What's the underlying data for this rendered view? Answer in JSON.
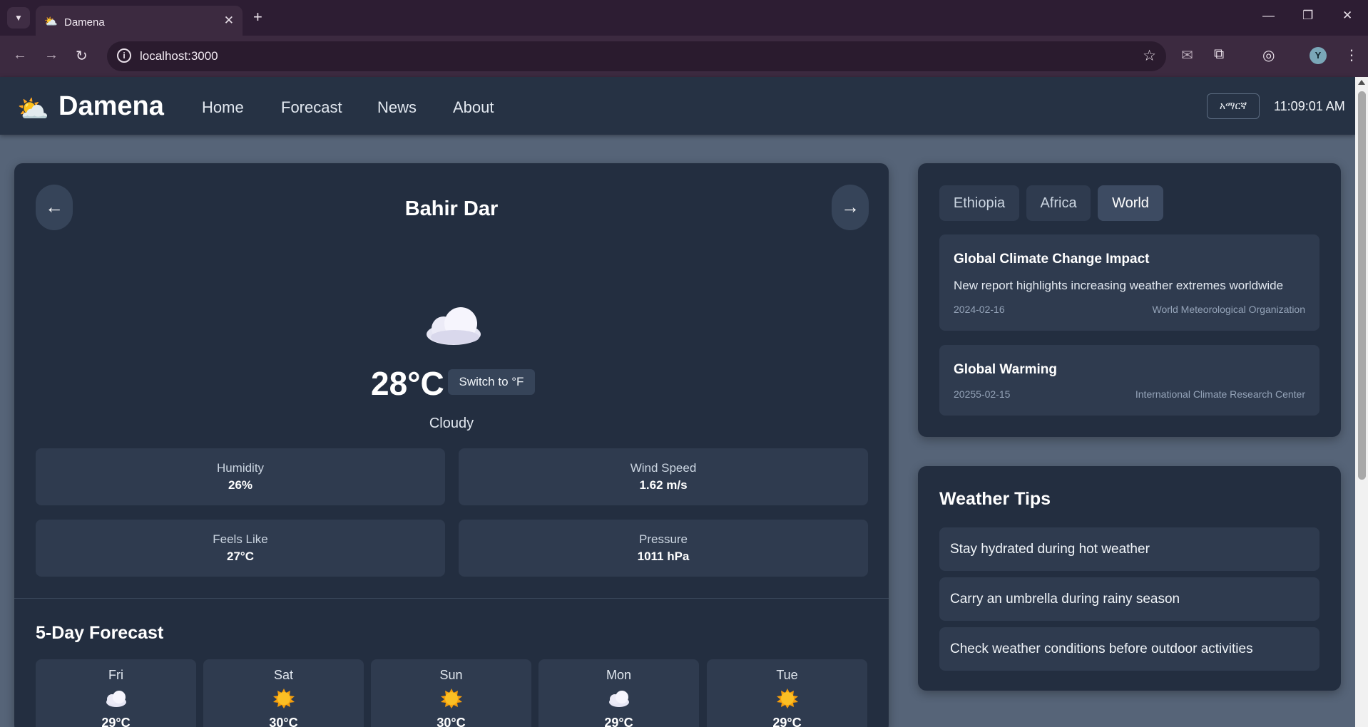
{
  "browser": {
    "tab_title": "Damena",
    "url": "localhost:3000",
    "profile_initial": "Y"
  },
  "app": {
    "name": "Damena",
    "nav": [
      "Home",
      "Forecast",
      "News",
      "About"
    ],
    "lang_button": "አማርኛ",
    "time": "11:09:01 AM"
  },
  "weather": {
    "city": "Bahir Dar",
    "prev_label": "←",
    "next_label": "→",
    "temperature": "28°C",
    "unit_toggle": "Switch to °F",
    "condition": "Cloudy",
    "stats": [
      {
        "label": "Humidity",
        "value": "26%"
      },
      {
        "label": "Wind Speed",
        "value": "1.62 m/s"
      },
      {
        "label": "Feels Like",
        "value": "27°C"
      },
      {
        "label": "Pressure",
        "value": "1011 hPa"
      }
    ]
  },
  "forecast": {
    "title": "5-Day Forecast",
    "days": [
      {
        "day": "Fri",
        "icon": "cloud-icon",
        "temp": "29°C"
      },
      {
        "day": "Sat",
        "icon": "sun-icon",
        "temp": "30°C"
      },
      {
        "day": "Sun",
        "icon": "sun-icon",
        "temp": "30°C"
      },
      {
        "day": "Mon",
        "icon": "cloud-icon",
        "temp": "29°C"
      },
      {
        "day": "Tue",
        "icon": "sun-icon",
        "temp": "29°C"
      }
    ]
  },
  "news": {
    "tabs": [
      "Ethiopia",
      "Africa",
      "World"
    ],
    "active_tab": "World",
    "items": [
      {
        "title": "Global Climate Change Impact",
        "description": "New report highlights increasing weather extremes worldwide",
        "date": "2024-02-16",
        "source": "World Meteorological Organization"
      },
      {
        "title": "Global Warming",
        "date": "20255-02-15",
        "source": "International Climate Research Center"
      }
    ]
  },
  "tips": {
    "title": "Weather Tips",
    "items": [
      "Stay hydrated during hot weather",
      "Carry an umbrella during rainy season",
      "Check weather conditions before outdoor activities"
    ]
  }
}
